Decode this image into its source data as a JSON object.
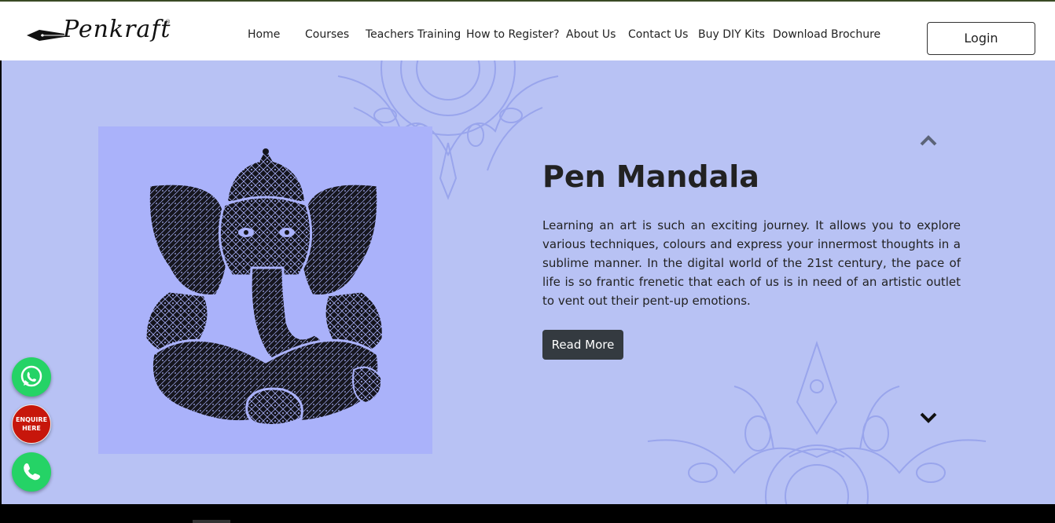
{
  "brand": {
    "name": "Penkraft",
    "logo_text": "Penkraft",
    "registered": "®"
  },
  "nav": {
    "items": [
      {
        "label": "Home"
      },
      {
        "label": "Courses"
      },
      {
        "label": "Teachers Training"
      },
      {
        "label": "How to Register?"
      },
      {
        "label": "About Us"
      },
      {
        "label": "Contact Us"
      },
      {
        "label": "Buy DIY Kits"
      },
      {
        "label": "Download Brochure"
      }
    ],
    "login_label": "Login"
  },
  "hero": {
    "title": "Pen Mandala",
    "description": "Learning an art is such an exciting journey. It allows you to explore various techniques, colours and express your innermost thoughts in a sublime manner. In the digital world of the 21st century, the pace of life is so frantic frenetic that each of us is in need of an artistic outlet to vent out their pent-up emotions.",
    "button_label": "Read More",
    "artwork": "ganesha-mandala-illustration",
    "up_icon": "chevron-up-icon",
    "down_icon": "chevron-down-icon"
  },
  "floating": {
    "whatsapp_icon": "whatsapp-icon",
    "enquire_label": "ENQUIRE HERE",
    "phone_icon": "phone-icon"
  },
  "colors": {
    "hero_bg": "#b8c2f4",
    "art_bg": "#aab2fa",
    "button_bg": "#343a40",
    "whatsapp": "#25d366",
    "enquire": "#c7160b"
  }
}
